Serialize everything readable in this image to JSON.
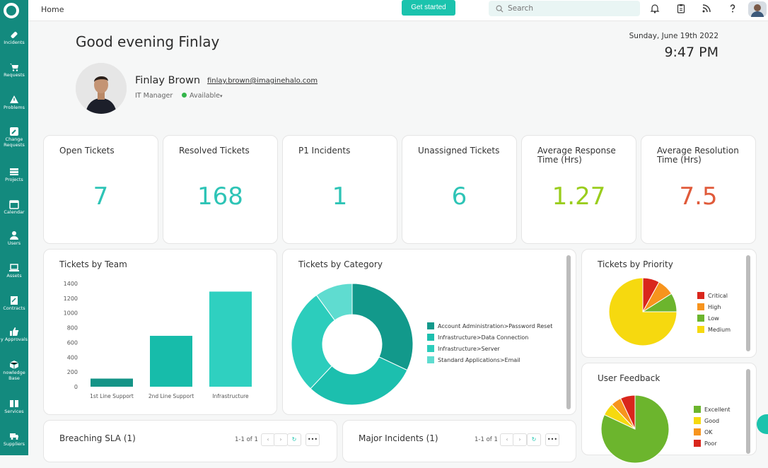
{
  "sidebar": {
    "items": [
      {
        "label": "Incidents",
        "icon": "bandage-icon"
      },
      {
        "label": "Requests",
        "icon": "cart-icon"
      },
      {
        "label": "Problems",
        "icon": "warning-icon"
      },
      {
        "label": "Change",
        "label2": "Requests",
        "icon": "edit-icon"
      },
      {
        "label": "Projects",
        "icon": "projects-icon"
      },
      {
        "label": "Calendar",
        "icon": "calendar-icon"
      },
      {
        "label": "Users",
        "icon": "user-icon"
      },
      {
        "label": "Assets",
        "icon": "laptop-icon"
      },
      {
        "label": "Contracts",
        "icon": "contract-icon"
      },
      {
        "label": "y Approvals",
        "icon": "thumbs-up-icon"
      },
      {
        "label": "nowledge",
        "label2": "Base",
        "icon": "box-icon"
      },
      {
        "label": "Services",
        "icon": "book-icon"
      },
      {
        "label": "Suppliers",
        "icon": "truck-icon"
      }
    ]
  },
  "topbar": {
    "breadcrumb": "Home",
    "get_started": "Get started",
    "search_placeholder": "Search"
  },
  "header": {
    "greeting": "Good evening Finlay",
    "date": "Sunday, June 19th 2022",
    "time": "9:47 PM"
  },
  "user": {
    "name": "Finlay Brown",
    "email": "finlay.brown@imaginehalo.com",
    "role": "IT Manager",
    "status": "Available"
  },
  "kpis": [
    {
      "title": "Open Tickets",
      "value": "7",
      "color": "#2ec4b6"
    },
    {
      "title": "Resolved Tickets",
      "value": "168",
      "color": "#2ec4b6"
    },
    {
      "title": "P1 Incidents",
      "value": "1",
      "color": "#2ec4b6"
    },
    {
      "title": "Unassigned Tickets",
      "value": "6",
      "color": "#2ec4b6"
    },
    {
      "title": "Average Response Time (Hrs)",
      "value": "1.27",
      "color": "#9acd1d"
    },
    {
      "title": "Average Resolution Time (Hrs)",
      "value": "7.5",
      "color": "#e05a3a"
    }
  ],
  "widgets": {
    "team_title": "Tickets by Team",
    "category_title": "Tickets by Category",
    "priority_title": "Tickets by Priority",
    "feedback_title": "User Feedback",
    "sla_title": "Breaching SLA (1)",
    "major_title": "Major Incidents (1)",
    "pager_text": "1-1 of 1"
  },
  "chart_data": [
    {
      "type": "bar",
      "title": "Tickets by Team",
      "categories": [
        "1st Line Support",
        "2nd Line Support",
        "Infrastructure"
      ],
      "values": [
        110,
        690,
        1290
      ],
      "ylim": [
        0,
        1400
      ],
      "yticks": [
        "0",
        "200",
        "400",
        "600",
        "800",
        "1000",
        "1200",
        "1400"
      ],
      "colors": [
        "#159487",
        "#17bcaa",
        "#2fd0c0"
      ]
    },
    {
      "type": "pie",
      "title": "Tickets by Category",
      "donut": true,
      "labels": [
        "Account Administration>Password Reset",
        "Infrastructure>Data Connection",
        "Infrastructure>Server",
        "Standard Applications>Email"
      ],
      "values": [
        32,
        30,
        28,
        10
      ],
      "colors": [
        "#12998b",
        "#1cbfae",
        "#2ccdbc",
        "#5fdcd0"
      ]
    },
    {
      "type": "pie",
      "title": "Tickets by Priority",
      "labels": [
        "Critical",
        "High",
        "Low",
        "Medium"
      ],
      "values": [
        8,
        8,
        9,
        75
      ],
      "colors": [
        "#d9261c",
        "#f7941d",
        "#6cb52d",
        "#f6d90f"
      ]
    },
    {
      "type": "pie",
      "title": "User Feedback",
      "labels": [
        "Excellent",
        "Good",
        "OK",
        "Poor"
      ],
      "values": [
        82,
        6,
        5,
        7
      ],
      "colors": [
        "#6cb52d",
        "#f6d90f",
        "#f7941d",
        "#d9261c"
      ]
    }
  ]
}
